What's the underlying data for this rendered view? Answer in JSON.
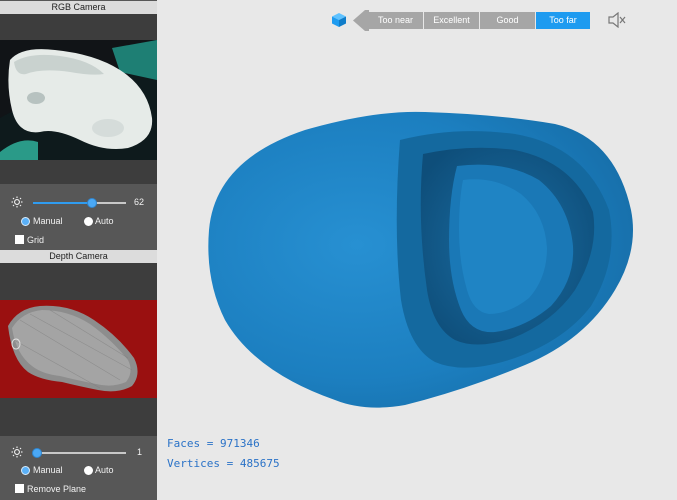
{
  "rgb_camera": {
    "title": "RGB Camera",
    "brightness_value": "62",
    "brightness_fraction": 0.62,
    "mode_manual": "Manual",
    "mode_auto": "Auto",
    "selected_mode": "Manual",
    "grid_label": "Grid"
  },
  "depth_camera": {
    "title": "Depth Camera",
    "value": "1",
    "value_fraction": 0.0,
    "mode_manual": "Manual",
    "mode_auto": "Auto",
    "selected_mode": "Manual",
    "remove_plane_label": "Remove Plane"
  },
  "distance_indicator": {
    "items": [
      "Too near",
      "Excellent",
      "Good",
      "Too far"
    ],
    "active": "Too far"
  },
  "icons": {
    "cube": "cube-icon",
    "arrow": "arrow-left-icon",
    "mute": "speaker-muted-icon",
    "brightness": "sun-icon"
  },
  "stats": {
    "faces": "Faces = 971346",
    "vertices": "Vertices = 485675"
  },
  "colors": {
    "accent": "#1e9bf0",
    "model": "#1f7fc0",
    "depth_bg": "#9a1010",
    "stats_text": "#2a72c7"
  }
}
